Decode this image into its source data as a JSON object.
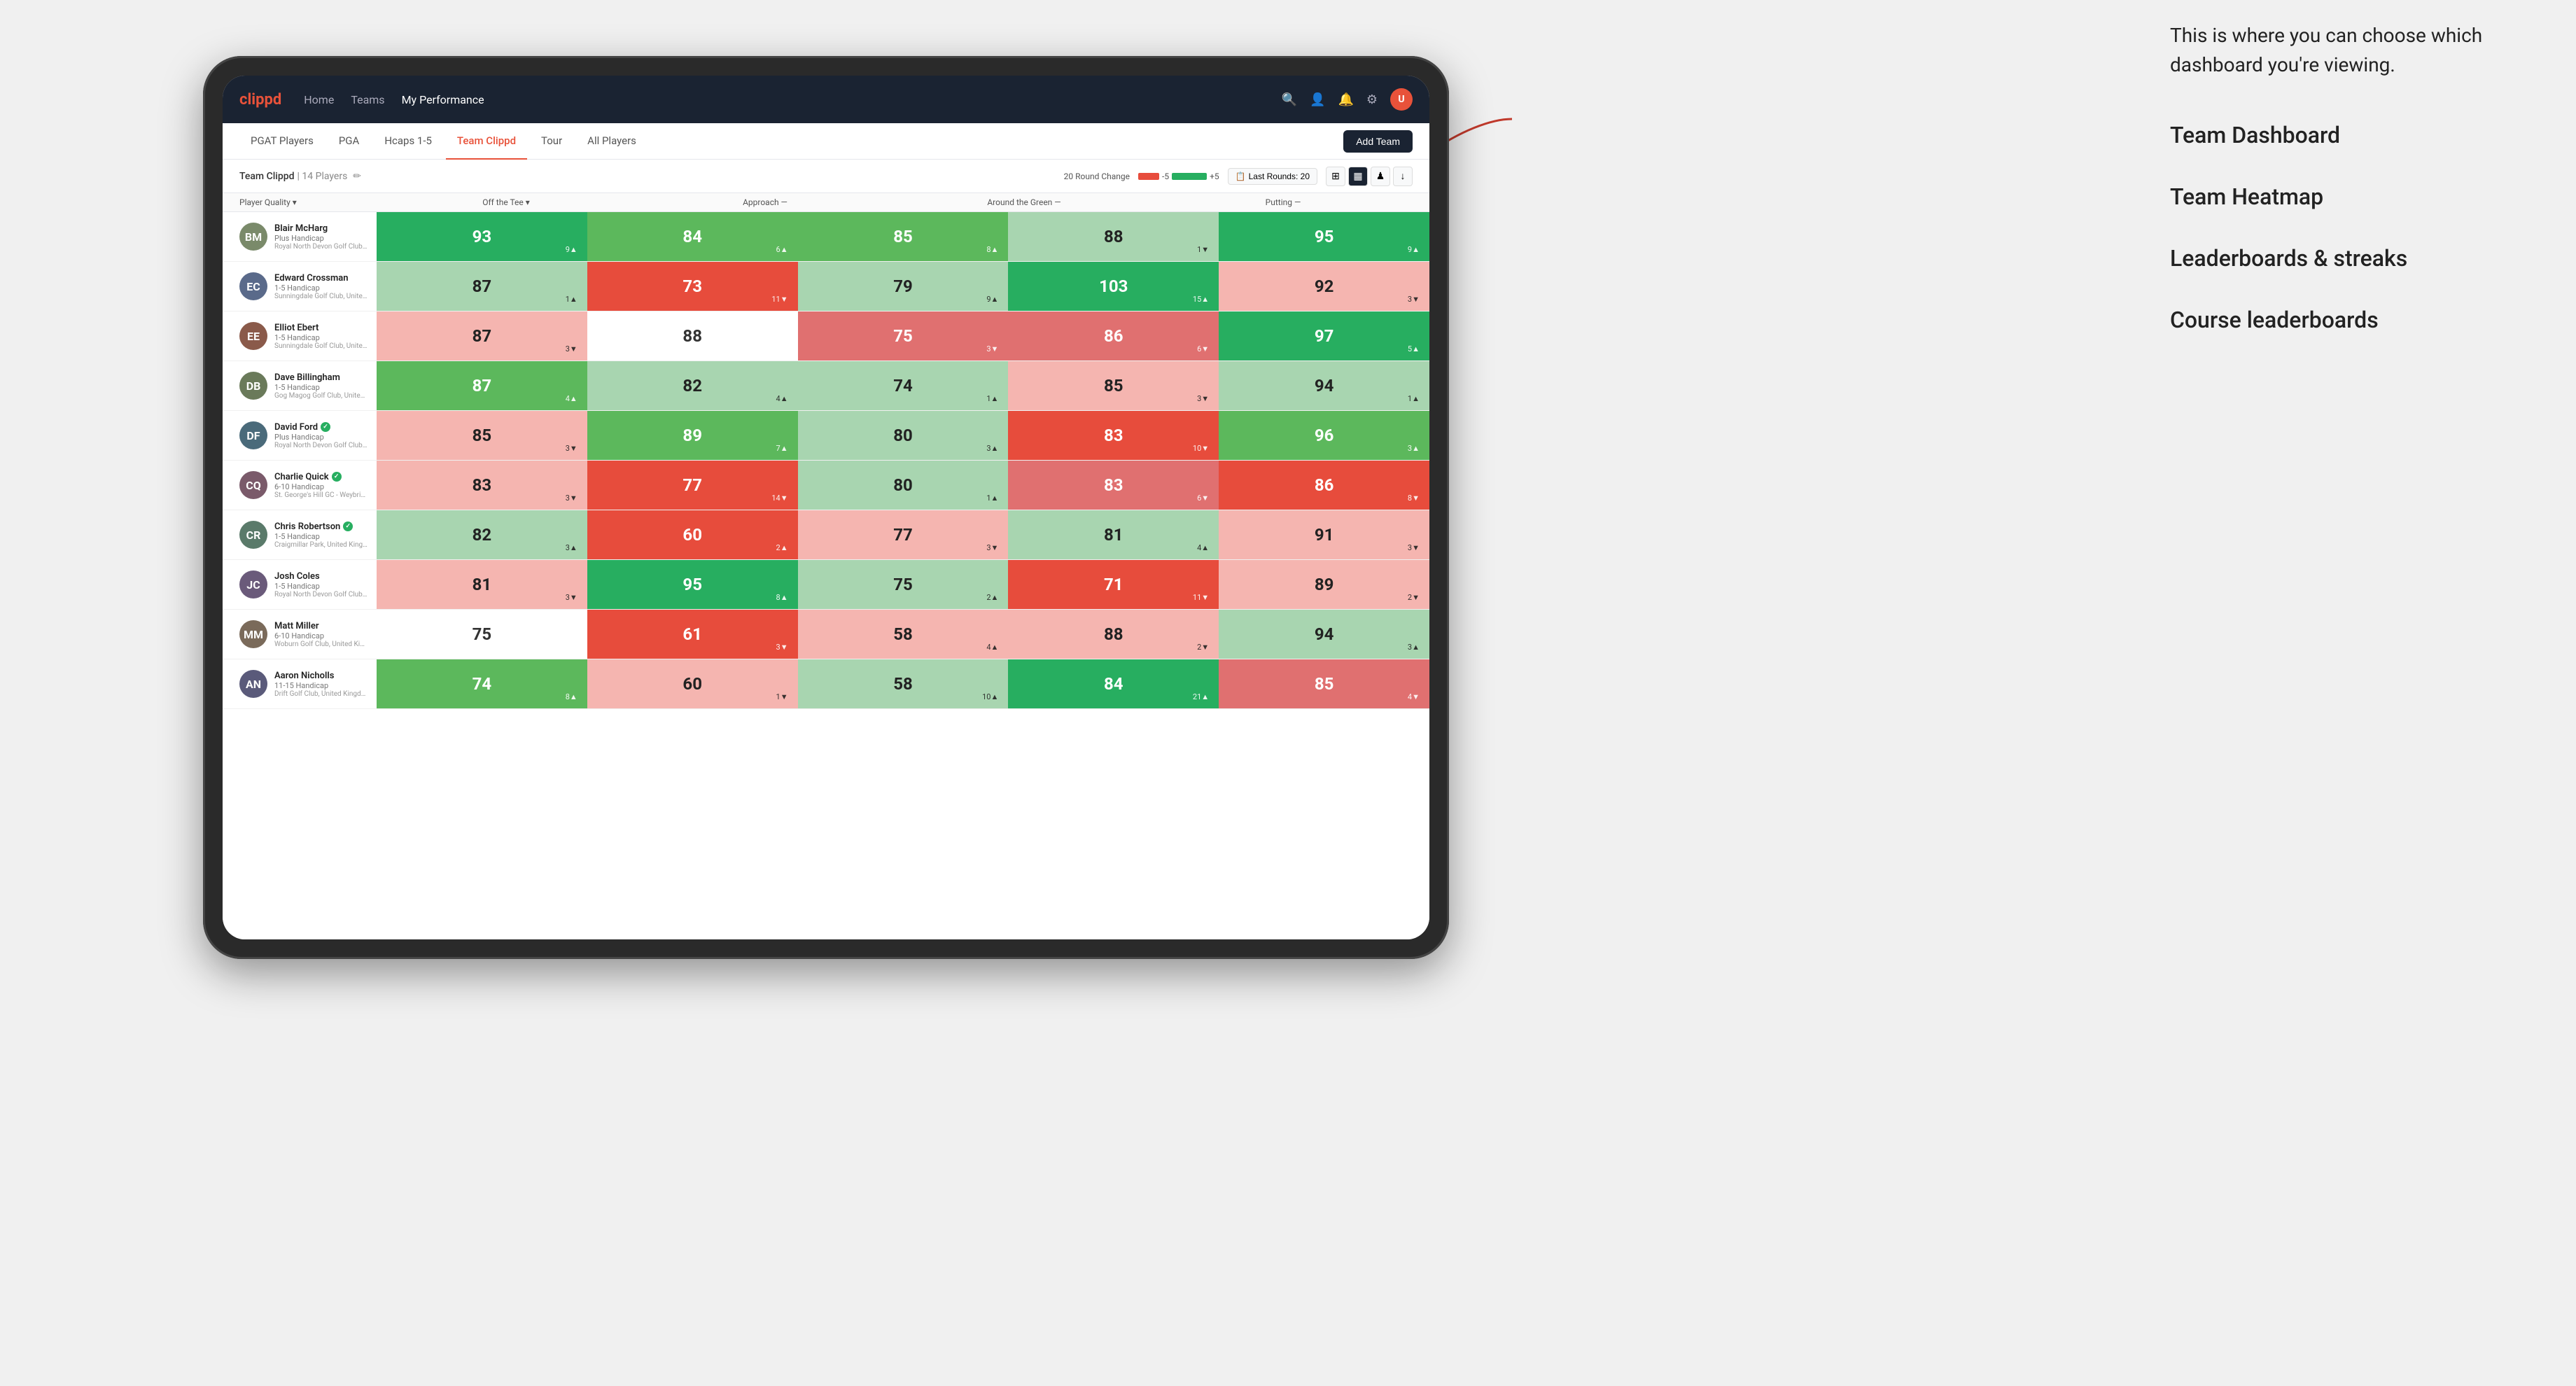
{
  "annotation": {
    "intro_text": "This is where you can choose which dashboard you're viewing.",
    "items": [
      {
        "label": "Team Dashboard"
      },
      {
        "label": "Team Heatmap"
      },
      {
        "label": "Leaderboards & streaks"
      },
      {
        "label": "Course leaderboards"
      }
    ]
  },
  "nav": {
    "logo": "clippd",
    "links": [
      {
        "label": "Home",
        "active": false
      },
      {
        "label": "Teams",
        "active": false
      },
      {
        "label": "My Performance",
        "active": true
      }
    ],
    "icons": [
      "search",
      "person",
      "bell",
      "settings",
      "avatar"
    ]
  },
  "sub_tabs": [
    {
      "label": "PGAT Players",
      "active": false
    },
    {
      "label": "PGA",
      "active": false
    },
    {
      "label": "Hcaps 1-5",
      "active": false
    },
    {
      "label": "Team Clippd",
      "active": true
    },
    {
      "label": "Tour",
      "active": false
    },
    {
      "label": "All Players",
      "active": false
    }
  ],
  "add_team_label": "Add Team",
  "team_info": {
    "name": "Team Clippd",
    "separator": "|",
    "count": "14 Players"
  },
  "controls": {
    "round_change_label": "20 Round Change",
    "minus_val": "-5",
    "plus_val": "+5",
    "last_rounds_label": "Last Rounds:",
    "last_rounds_val": "20"
  },
  "col_headers": {
    "player": "Player Quality ▾",
    "off_tee": "Off the Tee ▾",
    "approach": "Approach —",
    "around_green": "Around the Green —",
    "putting": "Putting —"
  },
  "players": [
    {
      "name": "Blair McHarg",
      "hcap": "Plus Handicap",
      "club": "Royal North Devon Golf Club, United Kingdom",
      "avatar_color": "#7a8a6a",
      "avatar_text": "BM",
      "quality": {
        "val": "93",
        "change": "9▲",
        "color": "green-dark"
      },
      "off_tee": {
        "val": "84",
        "change": "6▲",
        "color": "green-mid"
      },
      "approach": {
        "val": "85",
        "change": "8▲",
        "color": "green-mid"
      },
      "around_green": {
        "val": "88",
        "change": "1▼",
        "color": "green-light"
      },
      "putting": {
        "val": "95",
        "change": "9▲",
        "color": "green-dark"
      }
    },
    {
      "name": "Edward Crossman",
      "hcap": "1-5 Handicap",
      "club": "Sunningdale Golf Club, United Kingdom",
      "avatar_color": "#5a6a8a",
      "avatar_text": "EC",
      "quality": {
        "val": "87",
        "change": "1▲",
        "color": "green-light"
      },
      "off_tee": {
        "val": "73",
        "change": "11▼",
        "color": "red-dark"
      },
      "approach": {
        "val": "79",
        "change": "9▲",
        "color": "green-light"
      },
      "around_green": {
        "val": "103",
        "change": "15▲",
        "color": "green-dark"
      },
      "putting": {
        "val": "92",
        "change": "3▼",
        "color": "red-light"
      }
    },
    {
      "name": "Elliot Ebert",
      "hcap": "1-5 Handicap",
      "club": "Sunningdale Golf Club, United Kingdom",
      "avatar_color": "#8a5a4a",
      "avatar_text": "EE",
      "quality": {
        "val": "87",
        "change": "3▼",
        "color": "red-light"
      },
      "off_tee": {
        "val": "88",
        "change": "",
        "color": "neutral"
      },
      "approach": {
        "val": "75",
        "change": "3▼",
        "color": "red-mid"
      },
      "around_green": {
        "val": "86",
        "change": "6▼",
        "color": "red-mid"
      },
      "putting": {
        "val": "97",
        "change": "5▲",
        "color": "green-dark"
      }
    },
    {
      "name": "Dave Billingham",
      "hcap": "1-5 Handicap",
      "club": "Gog Magog Golf Club, United Kingdom",
      "avatar_color": "#6a7a5a",
      "avatar_text": "DB",
      "quality": {
        "val": "87",
        "change": "4▲",
        "color": "green-mid"
      },
      "off_tee": {
        "val": "82",
        "change": "4▲",
        "color": "green-light"
      },
      "approach": {
        "val": "74",
        "change": "1▲",
        "color": "green-light"
      },
      "around_green": {
        "val": "85",
        "change": "3▼",
        "color": "red-light"
      },
      "putting": {
        "val": "94",
        "change": "1▲",
        "color": "green-light"
      }
    },
    {
      "name": "David Ford",
      "hcap": "Plus Handicap",
      "club": "Royal North Devon Golf Club, United Kingdom",
      "verified": true,
      "avatar_color": "#4a6a7a",
      "avatar_text": "DF",
      "quality": {
        "val": "85",
        "change": "3▼",
        "color": "red-light"
      },
      "off_tee": {
        "val": "89",
        "change": "7▲",
        "color": "green-mid"
      },
      "approach": {
        "val": "80",
        "change": "3▲",
        "color": "green-light"
      },
      "around_green": {
        "val": "83",
        "change": "10▼",
        "color": "red-dark"
      },
      "putting": {
        "val": "96",
        "change": "3▲",
        "color": "green-mid"
      }
    },
    {
      "name": "Charlie Quick",
      "hcap": "6-10 Handicap",
      "club": "St. George's Hill GC - Weybridge - Surrey, Uni...",
      "verified": true,
      "avatar_color": "#7a5a6a",
      "avatar_text": "CQ",
      "quality": {
        "val": "83",
        "change": "3▼",
        "color": "red-light"
      },
      "off_tee": {
        "val": "77",
        "change": "14▼",
        "color": "red-dark"
      },
      "approach": {
        "val": "80",
        "change": "1▲",
        "color": "green-light"
      },
      "around_green": {
        "val": "83",
        "change": "6▼",
        "color": "red-mid"
      },
      "putting": {
        "val": "86",
        "change": "8▼",
        "color": "red-dark"
      }
    },
    {
      "name": "Chris Robertson",
      "hcap": "1-5 Handicap",
      "club": "Craigmillar Park, United Kingdom",
      "verified": true,
      "avatar_color": "#5a7a6a",
      "avatar_text": "CR",
      "quality": {
        "val": "82",
        "change": "3▲",
        "color": "green-light"
      },
      "off_tee": {
        "val": "60",
        "change": "2▲",
        "color": "red-dark"
      },
      "approach": {
        "val": "77",
        "change": "3▼",
        "color": "red-light"
      },
      "around_green": {
        "val": "81",
        "change": "4▲",
        "color": "green-light"
      },
      "putting": {
        "val": "91",
        "change": "3▼",
        "color": "red-light"
      }
    },
    {
      "name": "Josh Coles",
      "hcap": "1-5 Handicap",
      "club": "Royal North Devon Golf Club, United Kingdom",
      "avatar_color": "#6a5a7a",
      "avatar_text": "JC",
      "quality": {
        "val": "81",
        "change": "3▼",
        "color": "red-light"
      },
      "off_tee": {
        "val": "95",
        "change": "8▲",
        "color": "green-dark"
      },
      "approach": {
        "val": "75",
        "change": "2▲",
        "color": "green-light"
      },
      "around_green": {
        "val": "71",
        "change": "11▼",
        "color": "red-dark"
      },
      "putting": {
        "val": "89",
        "change": "2▼",
        "color": "red-light"
      }
    },
    {
      "name": "Matt Miller",
      "hcap": "6-10 Handicap",
      "club": "Woburn Golf Club, United Kingdom",
      "avatar_color": "#7a6a5a",
      "avatar_text": "MM",
      "quality": {
        "val": "75",
        "change": "",
        "color": "neutral"
      },
      "off_tee": {
        "val": "61",
        "change": "3▼",
        "color": "red-dark"
      },
      "approach": {
        "val": "58",
        "change": "4▲",
        "color": "red-light"
      },
      "around_green": {
        "val": "88",
        "change": "2▼",
        "color": "red-light"
      },
      "putting": {
        "val": "94",
        "change": "3▲",
        "color": "green-light"
      }
    },
    {
      "name": "Aaron Nicholls",
      "hcap": "11-15 Handicap",
      "club": "Drift Golf Club, United Kingdom",
      "avatar_color": "#5a5a7a",
      "avatar_text": "AN",
      "quality": {
        "val": "74",
        "change": "8▲",
        "color": "green-mid"
      },
      "off_tee": {
        "val": "60",
        "change": "1▼",
        "color": "red-light"
      },
      "approach": {
        "val": "58",
        "change": "10▲",
        "color": "green-light"
      },
      "around_green": {
        "val": "84",
        "change": "21▲",
        "color": "green-dark"
      },
      "putting": {
        "val": "85",
        "change": "4▼",
        "color": "red-mid"
      }
    }
  ]
}
